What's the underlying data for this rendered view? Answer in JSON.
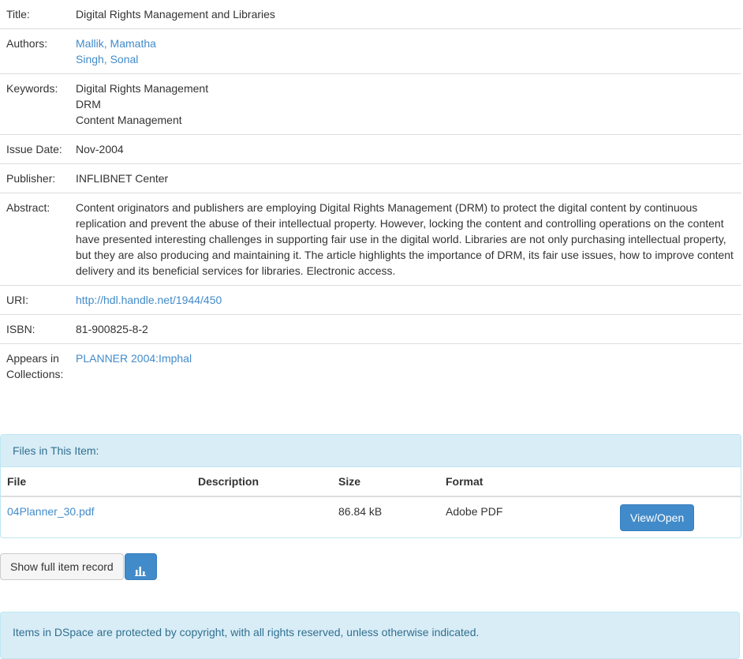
{
  "metadata": {
    "title": {
      "label": "Title:",
      "value": "Digital Rights Management and Libraries"
    },
    "authors": {
      "label": "Authors:",
      "items": [
        "Mallik, Mamatha",
        "Singh, Sonal"
      ]
    },
    "keywords": {
      "label": "Keywords:",
      "items": [
        "Digital Rights Management",
        "DRM",
        "Content Management"
      ]
    },
    "issue_date": {
      "label": "Issue Date:",
      "value": "Nov-2004"
    },
    "publisher": {
      "label": "Publisher:",
      "value": "INFLIBNET Center"
    },
    "abstract": {
      "label": "Abstract:",
      "value": "Content originators and publishers are employing Digital Rights Management (DRM) to protect the digital content by continuous replication and prevent the abuse of their intellectual property. However, locking the content and controlling operations on the content have presented interesting challenges in supporting fair use in the digital world. Libraries are not only purchasing intellectual property, but they are also producing and maintaining it. The article highlights the importance of DRM, its fair use issues, how to improve content delivery and its beneficial services for libraries. Electronic access."
    },
    "uri": {
      "label": "URI:",
      "value": "http://hdl.handle.net/1944/450"
    },
    "isbn": {
      "label": "ISBN:",
      "value": "81-900825-8-2"
    },
    "collections": {
      "label": "Appears in Collections:",
      "value": "PLANNER 2004:Imphal"
    }
  },
  "files": {
    "heading": "Files in This Item:",
    "columns": {
      "file": "File",
      "description": "Description",
      "size": "Size",
      "format": "Format"
    },
    "rows": [
      {
        "file": "04Planner_30.pdf",
        "description": "",
        "size": "86.84 kB",
        "format": "Adobe PDF",
        "action": "View/Open"
      }
    ]
  },
  "actions": {
    "show_full": "Show full item record",
    "stats_icon": "bar-chart-icon"
  },
  "footer": {
    "copyright": "Items in DSpace are protected by copyright, with all rights reserved, unless otherwise indicated."
  },
  "colors": {
    "link": "#428bca",
    "primary": "#428bca",
    "info_bg": "#d9edf7",
    "info_text": "#31708f",
    "info_border": "#bce8f1"
  }
}
